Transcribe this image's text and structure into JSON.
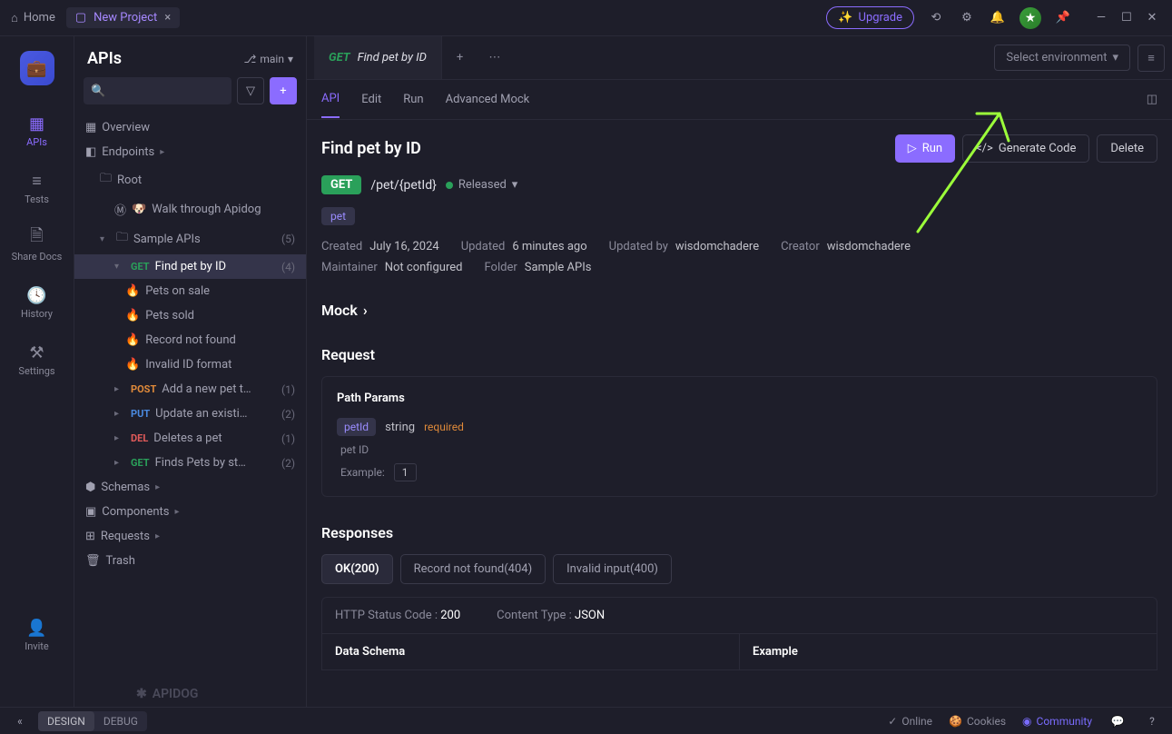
{
  "titlebar": {
    "home": "Home",
    "project": "New Project",
    "upgrade": "Upgrade"
  },
  "activity": [
    {
      "label": "APIs",
      "active": true
    },
    {
      "label": "Tests"
    },
    {
      "label": "Share Docs"
    },
    {
      "label": "History"
    },
    {
      "label": "Settings"
    }
  ],
  "invite": "Invite",
  "brand": "APIDOG",
  "sidebar": {
    "title": "APIs",
    "branch": "main",
    "overview": "Overview",
    "endpoints": "Endpoints",
    "root": "Root",
    "walkthrough": "Walk through Apidog",
    "sample": {
      "label": "Sample APIs",
      "count": "(5)"
    },
    "findpet": {
      "method": "GET",
      "label": "Find pet by ID",
      "count": "(4)"
    },
    "responses": [
      "Pets on sale",
      "Pets sold",
      "Record not found",
      "Invalid ID format"
    ],
    "siblings": [
      {
        "method": "POST",
        "label": "Add a new pet t…",
        "count": "(1)"
      },
      {
        "method": "PUT",
        "label": "Update an existi…",
        "count": "(2)"
      },
      {
        "method": "DEL",
        "label": "Deletes a pet",
        "count": "(1)"
      },
      {
        "method": "GET",
        "label": "Finds Pets by st…",
        "count": "(2)"
      }
    ],
    "schemas": "Schemas",
    "components": "Components",
    "requests": "Requests",
    "trash": "Trash"
  },
  "tabs": {
    "method": "GET",
    "label": "Find pet by ID",
    "env": "Select environment"
  },
  "subtabs": [
    "API",
    "Edit",
    "Run",
    "Advanced Mock"
  ],
  "page": {
    "title": "Find pet by ID",
    "run": "Run",
    "gencode": "Generate Code",
    "delete": "Delete",
    "method": "GET",
    "path": "/pet/{petId}",
    "released": "Released",
    "tag": "pet",
    "meta1": [
      {
        "k": "Created",
        "v": "July 16, 2024"
      },
      {
        "k": "Updated",
        "v": "6 minutes ago"
      },
      {
        "k": "Updated by",
        "v": "wisdomchadere"
      },
      {
        "k": "Creator",
        "v": "wisdomchadere"
      }
    ],
    "meta2": [
      {
        "k": "Maintainer",
        "v": "Not configured"
      },
      {
        "k": "Folder",
        "v": "Sample APIs"
      }
    ],
    "mock": "Mock",
    "request": "Request",
    "pathparams": "Path Params",
    "param": {
      "name": "petId",
      "type": "string",
      "req": "required",
      "desc": "pet ID",
      "exlabel": "Example:",
      "exval": "1"
    },
    "responses": "Responses",
    "resptabs": [
      {
        "label": "OK(200)",
        "active": true
      },
      {
        "label": "Record not found(404)"
      },
      {
        "label": "Invalid input(400)"
      }
    ],
    "httpcode": {
      "k": "HTTP Status Code",
      "v": "200"
    },
    "ctype": {
      "k": "Content Type",
      "v": "JSON"
    },
    "dataschema": "Data Schema",
    "example": "Example"
  },
  "footer": {
    "design": "DESIGN",
    "debug": "DEBUG",
    "online": "Online",
    "cookies": "Cookies",
    "community": "Community"
  }
}
